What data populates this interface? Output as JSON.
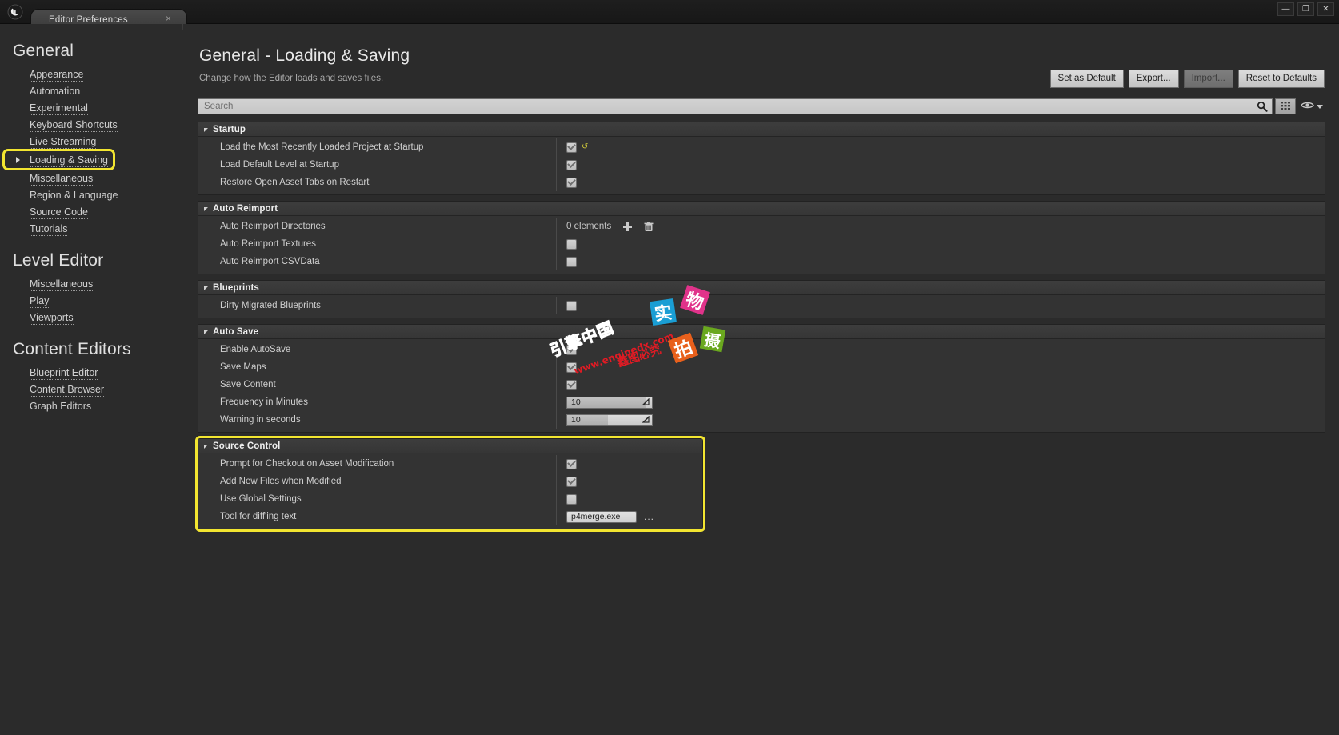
{
  "window": {
    "tab_label": "Editor Preferences",
    "close_tab": "×",
    "minimize": "—",
    "maximize": "❐",
    "close": "✕",
    "logo": "U"
  },
  "sidebar": {
    "groups": [
      {
        "title": "General",
        "items": [
          {
            "label": "Appearance",
            "selected": false
          },
          {
            "label": "Automation",
            "selected": false
          },
          {
            "label": "Experimental",
            "selected": false
          },
          {
            "label": "Keyboard Shortcuts",
            "selected": false
          },
          {
            "label": "Live Streaming",
            "selected": false
          },
          {
            "label": "Loading & Saving",
            "selected": true
          },
          {
            "label": "Miscellaneous",
            "selected": false
          },
          {
            "label": "Region & Language",
            "selected": false
          },
          {
            "label": "Source Code",
            "selected": false
          },
          {
            "label": "Tutorials",
            "selected": false
          }
        ]
      },
      {
        "title": "Level Editor",
        "items": [
          {
            "label": "Miscellaneous",
            "selected": false
          },
          {
            "label": "Play",
            "selected": false
          },
          {
            "label": "Viewports",
            "selected": false
          }
        ]
      },
      {
        "title": "Content Editors",
        "items": [
          {
            "label": "Blueprint Editor",
            "selected": false
          },
          {
            "label": "Content Browser",
            "selected": false
          },
          {
            "label": "Graph Editors",
            "selected": false
          }
        ]
      }
    ]
  },
  "header": {
    "title": "General - Loading & Saving",
    "subtitle": "Change how the Editor loads and saves files.",
    "buttons": [
      {
        "label": "Set as Default",
        "disabled": false
      },
      {
        "label": "Export...",
        "disabled": false
      },
      {
        "label": "Import...",
        "disabled": true
      },
      {
        "label": "Reset to Defaults",
        "disabled": false
      }
    ]
  },
  "search": {
    "value": "",
    "placeholder": "Search"
  },
  "categories": [
    {
      "title": "Startup",
      "highlight": false,
      "rows": [
        {
          "name": "Load the Most Recently Loaded Project at Startup",
          "type": "checkbox",
          "checked": true,
          "revert": true
        },
        {
          "name": "Load Default Level at Startup",
          "type": "checkbox",
          "checked": true,
          "revert": false
        },
        {
          "name": "Restore Open Asset Tabs on Restart",
          "type": "checkbox",
          "checked": true,
          "revert": false
        }
      ]
    },
    {
      "title": "Auto Reimport",
      "highlight": false,
      "rows": [
        {
          "name": "Auto Reimport Directories",
          "type": "array",
          "elements": "0 elements",
          "add_icon": "plus-icon",
          "delete_icon": "trash-icon"
        },
        {
          "name": "Auto Reimport Textures",
          "type": "checkbox",
          "checked": false,
          "revert": false
        },
        {
          "name": "Auto Reimport CSVData",
          "type": "checkbox",
          "checked": false,
          "revert": false
        }
      ]
    },
    {
      "title": "Blueprints",
      "highlight": false,
      "rows": [
        {
          "name": "Dirty Migrated Blueprints",
          "type": "checkbox",
          "checked": false,
          "revert": false
        }
      ]
    },
    {
      "title": "Auto Save",
      "highlight": false,
      "rows": [
        {
          "name": "Enable AutoSave",
          "type": "checkbox",
          "checked": true,
          "revert": false
        },
        {
          "name": "Save Maps",
          "type": "checkbox",
          "checked": true,
          "revert": false
        },
        {
          "name": "Save Content",
          "type": "checkbox",
          "checked": true,
          "revert": false
        },
        {
          "name": "Frequency in Minutes",
          "type": "number",
          "value": "10",
          "fill_pct": 92
        },
        {
          "name": "Warning in seconds",
          "type": "number",
          "value": "10",
          "fill_pct": 48
        }
      ]
    },
    {
      "title": "Source Control",
      "highlight": true,
      "rows": [
        {
          "name": "Prompt for Checkout on Asset Modification",
          "type": "checkbox",
          "checked": true,
          "revert": false
        },
        {
          "name": "Add New Files when Modified",
          "type": "checkbox",
          "checked": true,
          "revert": false
        },
        {
          "name": "Use Global Settings",
          "type": "checkbox",
          "checked": false,
          "revert": false
        },
        {
          "name": "Tool for diff'ing text",
          "type": "text",
          "value": "p4merge.exe",
          "browse": "..."
        }
      ]
    }
  ],
  "watermark": {
    "tiles": [
      {
        "char": "实",
        "bg": "#1a9ed4"
      },
      {
        "char": "物",
        "bg": "#e0338a"
      },
      {
        "char": "拍",
        "bg": "#e8601c"
      },
      {
        "char": "摄",
        "bg": "#6aa81e"
      }
    ],
    "brand": "引擎中国",
    "url": "www.enginedx.com",
    "tagline": "鑫图必究",
    "colors": {
      "brand": "#e8329b",
      "url": "#e01b24",
      "tagline": "#e01b24"
    }
  },
  "icons": {
    "search": "search-icon",
    "grid_view": "grid-view-icon",
    "eye": "eye-icon",
    "chevron_down": "chevron-down-icon"
  }
}
